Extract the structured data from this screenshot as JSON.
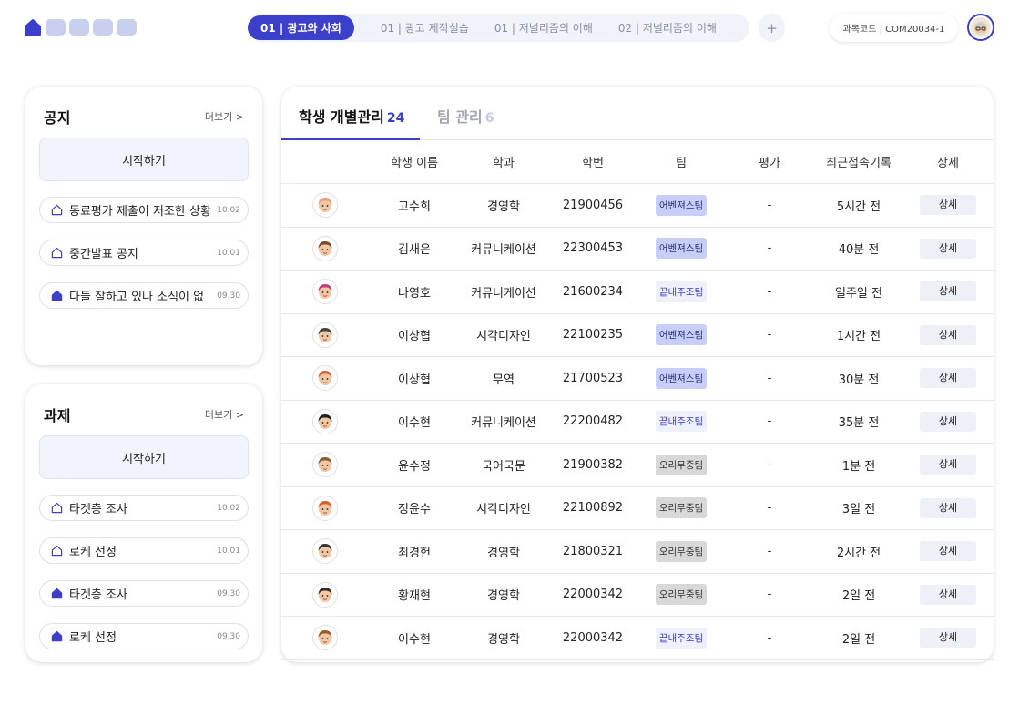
{
  "header": {
    "logo_name": "home-logo",
    "course_tabs": [
      {
        "label": "01 | 광고와 사회",
        "active": true
      },
      {
        "label": "01 | 광고 제작실습",
        "active": false
      },
      {
        "label": "01 | 저널리즘의 이해",
        "active": false
      },
      {
        "label": "02 | 저널리즘의 이해",
        "active": false
      }
    ],
    "add_tab_label": "+",
    "course_code": "과목코드 | COM20034-1"
  },
  "notice": {
    "title": "공지",
    "more": "더보기 >",
    "start": "시작하기",
    "items": [
      {
        "text": "동료평가 제출이 저조한 상황",
        "date": "10.02",
        "filled": false
      },
      {
        "text": "중간발표 공지",
        "date": "10.01",
        "filled": false
      },
      {
        "text": "다들 잘하고 있나 소식이 없",
        "date": "09.30",
        "filled": true
      }
    ]
  },
  "task": {
    "title": "과제",
    "more": "더보기 >",
    "start": "시작하기",
    "items": [
      {
        "text": "타겟층 조사",
        "date": "10.02",
        "filled": false
      },
      {
        "text": "로케 선정",
        "date": "10.01",
        "filled": false
      },
      {
        "text": "타겟층 조사",
        "date": "09.30",
        "filled": true
      },
      {
        "text": "로케 선정",
        "date": "09.30",
        "filled": true
      }
    ]
  },
  "main": {
    "tabs": [
      {
        "label": "학생 개별관리",
        "count": "24"
      },
      {
        "label": "팀 관리",
        "count": "6"
      }
    ],
    "columns": [
      "학생 이름",
      "학과",
      "학번",
      "팀",
      "평가",
      "최근접속기록",
      "상세"
    ],
    "rows": [
      {
        "name": "고수희",
        "major": "경영학",
        "id": "21900456",
        "team": "어벤져스팀",
        "team_style": "blue",
        "eval": "-",
        "recent": "5시간 전",
        "detail": "상세",
        "avatar_color": "#e8a07a"
      },
      {
        "name": "김새은",
        "major": "커뮤니케이션",
        "id": "22300453",
        "team": "어벤져스팀",
        "team_style": "blue",
        "eval": "-",
        "recent": "40분 전",
        "detail": "상세",
        "avatar_color": "#7a4a2a"
      },
      {
        "name": "나영호",
        "major": "커뮤니케이션",
        "id": "21600234",
        "team": "끝내주조팀",
        "team_style": "light",
        "eval": "-",
        "recent": "일주일 전",
        "detail": "상세",
        "avatar_color": "#c2407a"
      },
      {
        "name": "이상협",
        "major": "시각디자인",
        "id": "22100235",
        "team": "어벤져스팀",
        "team_style": "blue",
        "eval": "-",
        "recent": "1시간 전",
        "detail": "상세",
        "avatar_color": "#444444"
      },
      {
        "name": "이상협",
        "major": "무역",
        "id": "21700523",
        "team": "어벤져스팀",
        "team_style": "blue",
        "eval": "-",
        "recent": "30분 전",
        "detail": "상세",
        "avatar_color": "#d4623a"
      },
      {
        "name": "이수현",
        "major": "커뮤니케이션",
        "id": "22200482",
        "team": "끝내주조팀",
        "team_style": "light",
        "eval": "-",
        "recent": "35분 전",
        "detail": "상세",
        "avatar_color": "#222222"
      },
      {
        "name": "윤수정",
        "major": "국어국문",
        "id": "21900382",
        "team": "오리무중팀",
        "team_style": "gray",
        "eval": "-",
        "recent": "1분 전",
        "detail": "상세",
        "avatar_color": "#8a5a3a"
      },
      {
        "name": "정윤수",
        "major": "시각디자인",
        "id": "22100892",
        "team": "오리무중팀",
        "team_style": "gray",
        "eval": "-",
        "recent": "3일 전",
        "detail": "상세",
        "avatar_color": "#d4622a"
      },
      {
        "name": "최경헌",
        "major": "경영학",
        "id": "21800321",
        "team": "오리무중팀",
        "team_style": "gray",
        "eval": "-",
        "recent": "2시간 전",
        "detail": "상세",
        "avatar_color": "#333333"
      },
      {
        "name": "황재현",
        "major": "경영학",
        "id": "22000342",
        "team": "오리무중팀",
        "team_style": "gray",
        "eval": "-",
        "recent": "2일 전",
        "detail": "상세",
        "avatar_color": "#3a2a22"
      },
      {
        "name": "이수현",
        "major": "경영학",
        "id": "22000342",
        "team": "끝내주조팀",
        "team_style": "light",
        "eval": "-",
        "recent": "2일 전",
        "detail": "상세",
        "avatar_color": "#9a5a2a"
      }
    ]
  },
  "colors": {
    "accent": "#3b3fc9",
    "badge_blue": "#c7cef8",
    "badge_light": "#eef0fc",
    "badge_gray": "#d8d8d8"
  }
}
